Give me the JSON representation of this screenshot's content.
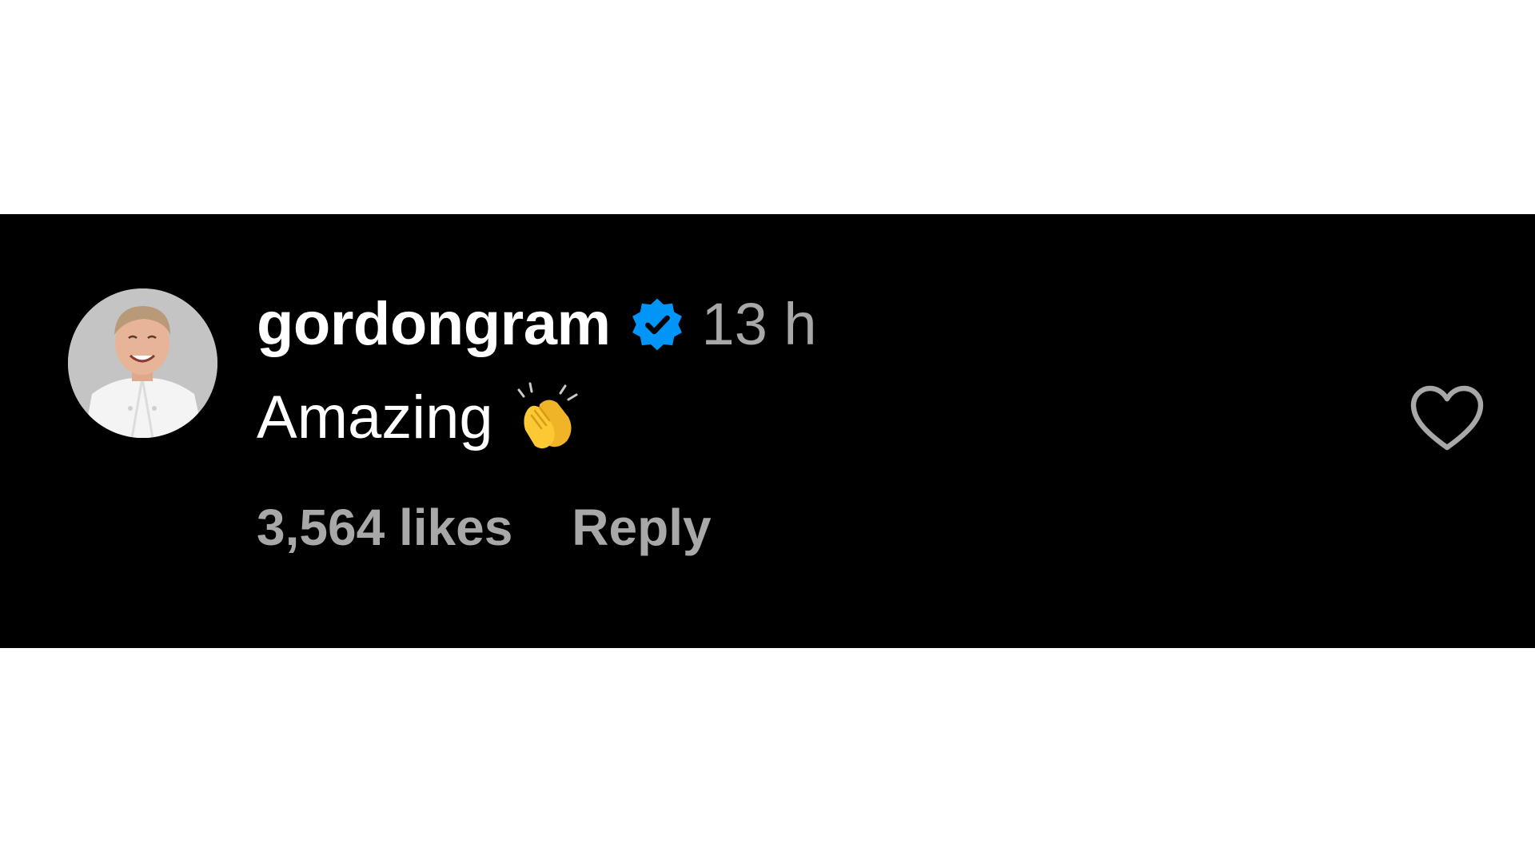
{
  "comment": {
    "username": "gordongram",
    "verified_icon": "verified-badge-icon",
    "timestamp": "13 h",
    "text": "Amazing",
    "emoji_icon": "clapping-hands-icon",
    "likes": "3,564 likes",
    "reply_label": "Reply",
    "like_icon": "heart-outline-icon"
  },
  "colors": {
    "background": "#000000",
    "text_primary": "#ffffff",
    "text_secondary": "#a8a8a8",
    "verified_blue": "#0095f6"
  }
}
